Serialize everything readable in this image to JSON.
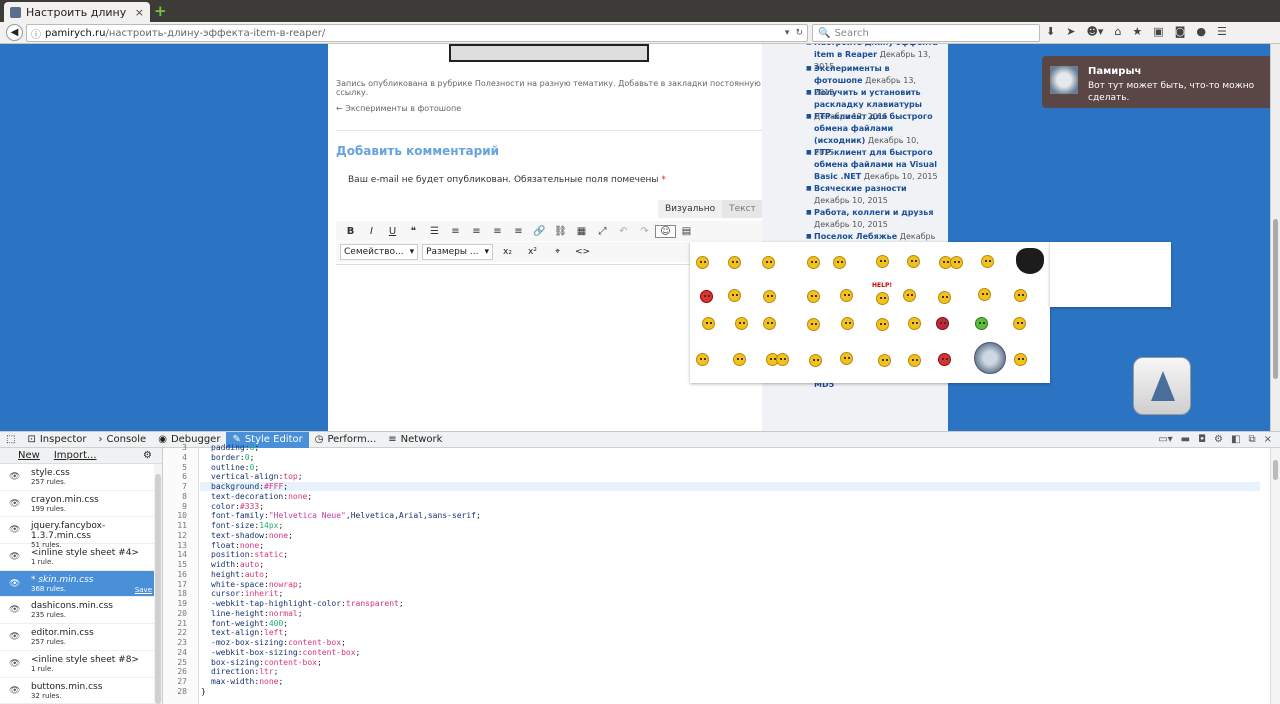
{
  "browser": {
    "tab_title": "Настроить длину э...",
    "tab_close": "×",
    "new_tab": "+",
    "url_host": "pamirych.ru",
    "url_path": "/настроить-длину-эффекта-item-в-reaper/",
    "search_placeholder": "Search",
    "nav_icons": [
      "download-icon",
      "send-icon",
      "addon-icon",
      "home-icon",
      "star-icon",
      "clipboard-icon",
      "pocket-icon",
      "chat-icon",
      "menu-icon"
    ]
  },
  "page": {
    "posted_text": "Запись опубликована в рубрике Полезности на разную тематику. Добавьте в закладки постоянную ссылку.",
    "prev_post": "← Эксперименты в фотошопе",
    "comment_heading": "Добавить комментарий",
    "notice": "Ваш e-mail не будет опубликован. Обязательные поля помечены",
    "notice_req": "*",
    "editor_tabs": [
      "Визуально",
      "Текст"
    ],
    "toolbar1": [
      "B",
      "I",
      "U",
      "❝",
      "☰",
      "≡",
      "≡",
      "≡",
      "≡",
      "🔗",
      "⛓",
      "▦",
      "⤢",
      "↶",
      "↷",
      "☺",
      "▤"
    ],
    "font_family_label": "Семейство...",
    "font_size_label": "Размеры ...",
    "toolbar2_extra": [
      "x₂",
      "x²",
      "⌖",
      "<>"
    ]
  },
  "sidebar": {
    "items": [
      {
        "link": "Настроить длину эффекта item в Reaper",
        "date": "Декабрь 13, 2015"
      },
      {
        "link": "Эксперименты в фотошопе",
        "date": "Декабрь 13, 2015"
      },
      {
        "link": "Получить и установить раскладку клавиатуры",
        "date": "Декабрь 12, 2015"
      },
      {
        "link": "FTP-клиент для быстрого обмена файлами (исходник)",
        "date": "Декабрь 10, 2015"
      },
      {
        "link": "FTP-клиент для быстрого обмена файлами на Visual Basic .NET",
        "date": "Декабрь 10, 2015"
      },
      {
        "link": "Всяческие разности",
        "date": "Декабрь 10, 2015"
      },
      {
        "link": "Работа, коллеги и друзья",
        "date": "Декабрь 10, 2015"
      },
      {
        "link": "Поселок Лебяжье",
        "date": "Декабрь 10,"
      }
    ],
    "tail_text": "MD5"
  },
  "notification": {
    "title": "Памирыч",
    "body": "Вот тут может быть, что-то можно сделать."
  },
  "smileys": {
    "help_label": "HELP!"
  },
  "devtools": {
    "tabs": [
      "Inspector",
      "Console",
      "Debugger",
      "Style Editor",
      "Perform...",
      "Network"
    ],
    "active_tab": "Style Editor",
    "new_label": "New",
    "import_label": "Import...",
    "save_label": "Save",
    "sheets": [
      {
        "name": "style.css",
        "rules": "257 rules."
      },
      {
        "name": "crayon.min.css",
        "rules": "199 rules."
      },
      {
        "name": "jquery.fancybox-1.3.7.min.css",
        "rules": "51 rules."
      },
      {
        "name": "<inline style sheet #4>",
        "rules": "1 rule."
      },
      {
        "name": "* skin.min.css",
        "rules": "368 rules.",
        "selected": true
      },
      {
        "name": "dashicons.min.css",
        "rules": "235 rules."
      },
      {
        "name": "editor.min.css",
        "rules": "257 rules."
      },
      {
        "name": "<inline style sheet #8>",
        "rules": "1 rule."
      },
      {
        "name": "buttons.min.css",
        "rules": "32 rules."
      }
    ],
    "code_lines": [
      {
        "n": "3",
        "prop": "padding",
        "val": "0"
      },
      {
        "n": "4",
        "prop": "border",
        "val": "0"
      },
      {
        "n": "5",
        "prop": "outline",
        "val": "0"
      },
      {
        "n": "6",
        "prop": "vertical-align",
        "val": "top"
      },
      {
        "n": "7",
        "prop": "background",
        "val": "#FFF"
      },
      {
        "n": "8",
        "prop": "text-decoration",
        "val": "none"
      },
      {
        "n": "9",
        "prop": "color",
        "val": "#333"
      },
      {
        "n": "10",
        "prop": "font-family",
        "val": "\"Helvetica Neue\",Helvetica,Arial,sans-serif"
      },
      {
        "n": "11",
        "prop": "font-size",
        "val": "14px"
      },
      {
        "n": "12",
        "prop": "text-shadow",
        "val": "none"
      },
      {
        "n": "13",
        "prop": "float",
        "val": "none"
      },
      {
        "n": "14",
        "prop": "position",
        "val": "static"
      },
      {
        "n": "15",
        "prop": "width",
        "val": "auto"
      },
      {
        "n": "16",
        "prop": "height",
        "val": "auto"
      },
      {
        "n": "17",
        "prop": "white-space",
        "val": "nowrap"
      },
      {
        "n": "18",
        "prop": "cursor",
        "val": "inherit"
      },
      {
        "n": "19",
        "prop": "-webkit-tap-highlight-color",
        "val": "transparent"
      },
      {
        "n": "20",
        "prop": "line-height",
        "val": "normal"
      },
      {
        "n": "21",
        "prop": "font-weight",
        "val": "400"
      },
      {
        "n": "22",
        "prop": "text-align",
        "val": "left"
      },
      {
        "n": "23",
        "prop": "-moz-box-sizing",
        "val": "content-box"
      },
      {
        "n": "24",
        "prop": "-webkit-box-sizing",
        "val": "content-box"
      },
      {
        "n": "25",
        "prop": "box-sizing",
        "val": "content-box"
      },
      {
        "n": "26",
        "prop": "direction",
        "val": "ltr"
      },
      {
        "n": "27",
        "prop": "max-width",
        "val": "none"
      }
    ],
    "closing_line": {
      "n": "28",
      "text": "}"
    }
  },
  "colors": {
    "page_bg": "#2b74c4",
    "accent": "#4a90d9",
    "heading": "#66a3df",
    "link": "#1a4f9a"
  }
}
